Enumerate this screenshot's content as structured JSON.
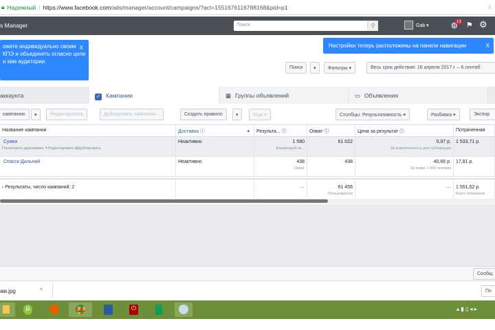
{
  "browser": {
    "secure_label": "Надежный",
    "url_host": "https://www.facebook.com",
    "url_path": "/ads/manager/account/campaigns/?act=1551676116788168&pid=p1"
  },
  "header": {
    "title": "s Manager",
    "search_placeholder": "Поиск",
    "user": "Gab ▾",
    "notif_count": "13"
  },
  "tooltips": {
    "left": "ожете индивидуально своим КПЭ и объединять огласно цели и ким аудитории.",
    "right": "Настройки теперь расположены на панели навигации",
    "close": "X"
  },
  "filters": {
    "search": "Поиск",
    "filters": "Фильтры ▾",
    "date_range": "Весь срок действия: 16 апреля 2017 г. – 6 сентяб"
  },
  "tabs": [
    "аккаунта",
    "Кампании",
    "Группы объявлений",
    "Объявления"
  ],
  "toolbar": {
    "create": "кампанию",
    "edit": "Редактировать",
    "duplicate": "Дублировать кампании...",
    "rule": "Создать правило",
    "more": "Еще ▾",
    "columns": "Столбцы: Результативность ▾",
    "breakdown": "Разбивка ▾",
    "export": "Экспор"
  },
  "table": {
    "headers": [
      "Название кампании",
      "Доставка",
      "Результа...",
      "Охват",
      "Цена за результат",
      "Потраченная"
    ],
    "rows": [
      {
        "name": "Сумки",
        "actions": [
          "Посмотреть диаграммы",
          "Редактировать",
          "Дублировать"
        ],
        "delivery": "Неактивно",
        "results": "1 580",
        "results_sub": "Взаимодейств...",
        "reach": "61 022",
        "cost": "0,97 р.",
        "cost_sub": "За вовлеченность для публикации",
        "spent": "1 533,71 р."
      },
      {
        "name": "Спасск-Дальний",
        "delivery": "Неактивно",
        "results": "438",
        "results_sub": "Охват",
        "reach": "438",
        "cost": "40,66 р.",
        "cost_sub": "За охват 1 000 человек",
        "spent": "17,81 р."
      }
    ],
    "total": {
      "label": "Результаты, число кампаний: 2",
      "results": "—",
      "reach": "61 456",
      "reach_sub": "Пользователи",
      "cost": "—",
      "spent": "1 551,52 р.",
      "spent_sub": "Всего потрачено"
    }
  },
  "footer": {
    "messages": "Сообщ",
    "download_file": "ам.jpg",
    "show_all": "По"
  }
}
